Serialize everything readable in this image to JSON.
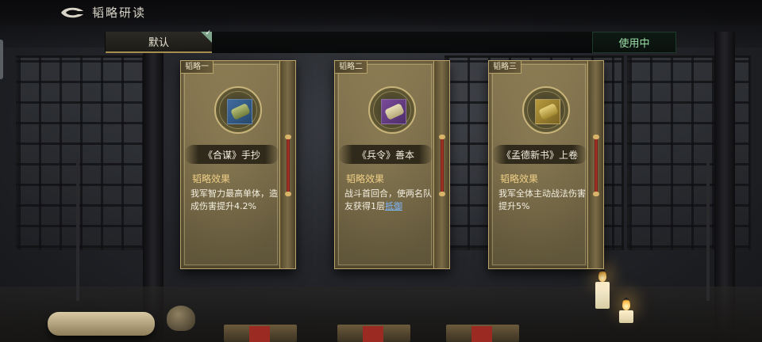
{
  "header": {
    "title": "韬略研读"
  },
  "tabs": {
    "default_label": "默认",
    "in_use_label": "使用中"
  },
  "cards": [
    {
      "tag": "韬略一",
      "item_name": "《合谋》手抄",
      "effect_label": "韬略效果",
      "effect_text": "我军智力最高单体，造成伤害提升4.2%",
      "icon": "scroll-bundle-blue-icon"
    },
    {
      "tag": "韬略二",
      "item_name": "《兵令》善本",
      "effect_label": "韬略效果",
      "effect_text_main": "战斗首回合，使两名队友获得1层",
      "effect_link": "抵御",
      "icon": "scroll-purple-icon"
    },
    {
      "tag": "韬略三",
      "item_name": "《孟德新书》上卷",
      "effect_label": "韬略效果",
      "effect_text": "我军全体主动战法伤害提升5%",
      "icon": "scroll-bundle-gold-icon"
    }
  ],
  "colors": {
    "accent_green": "#9de0a8",
    "effect_gold": "#f0cf86",
    "link_blue": "#7fb8ff",
    "card_bg": "#7a6c48"
  }
}
